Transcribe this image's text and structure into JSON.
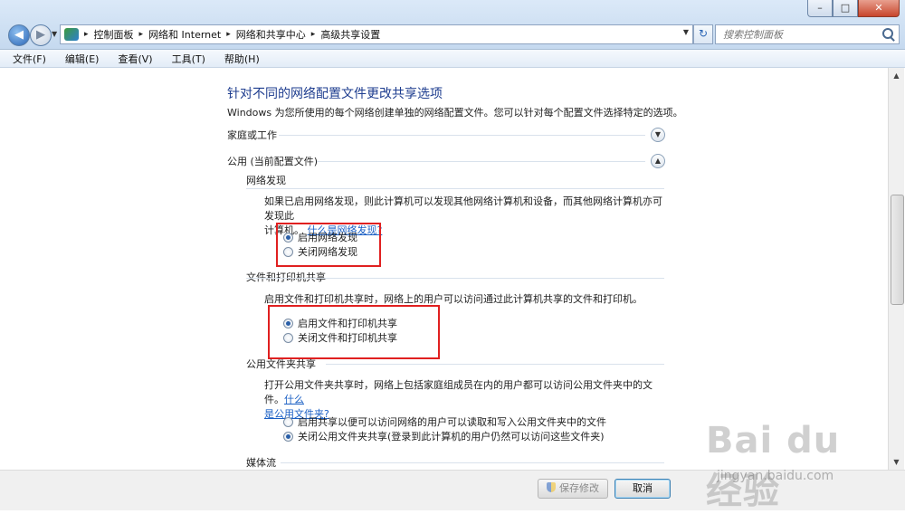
{
  "window": {
    "minimize_label": "–",
    "maximize_label": "□",
    "close_label": "✕"
  },
  "nav": {
    "back_icon": "back-arrow-icon",
    "forward_icon": "forward-arrow-icon"
  },
  "address": {
    "crumbs": [
      "控制面板",
      "网络和 Internet",
      "网络和共享中心",
      "高级共享设置"
    ],
    "separator": "▸"
  },
  "search": {
    "placeholder": "搜索控制面板"
  },
  "menu": {
    "file": "文件(F)",
    "edit": "编辑(E)",
    "view": "查看(V)",
    "tools": "工具(T)",
    "help": "帮助(H)"
  },
  "main": {
    "heading": "针对不同的网络配置文件更改共享选项",
    "subtitle": "Windows 为您所使用的每个网络创建单独的网络配置文件。您可以针对每个配置文件选择特定的选项。",
    "profile_home": "家庭或工作",
    "profile_public": "公用 (当前配置文件)",
    "discovery": {
      "title": "网络发现",
      "desc_line1": "如果已启用网络发现，则此计算机可以发现其他网络计算机和设备，而其他网络计算机亦可发现此",
      "desc_line2": "计算机。",
      "link": "什么是网络发现?",
      "option_on": "启用网络发现",
      "option_off": "关闭网络发现"
    },
    "printer_sharing": {
      "title": "文件和打印机共享",
      "desc": "启用文件和打印机共享时，网络上的用户可以访问通过此计算机共享的文件和打印机。",
      "option_on": "启用文件和打印机共享",
      "option_off": "关闭文件和打印机共享"
    },
    "public_folder": {
      "title": "公用文件夹共享",
      "desc_line1": "打开公用文件夹共享时，网络上包括家庭组成员在内的用户都可以访问公用文件夹中的文件。",
      "link_part1": "什么",
      "link_part2": "是公用文件夹?",
      "option_on": "启用共享以便可以访问网络的用户可以读取和写入公用文件夹中的文件",
      "option_off": "关闭公用文件夹共享(登录到此计算机的用户仍然可以访问这些文件夹)"
    },
    "media": {
      "title": "媒体流"
    }
  },
  "footer": {
    "save": "保存修改",
    "cancel": "取消"
  },
  "watermark": {
    "logo": "Bai du 经验",
    "url": "jingyan.baidu.com"
  },
  "colors": {
    "heading": "#1e3d8f",
    "link": "#1a5fc4",
    "highlight_box": "#e02020"
  }
}
